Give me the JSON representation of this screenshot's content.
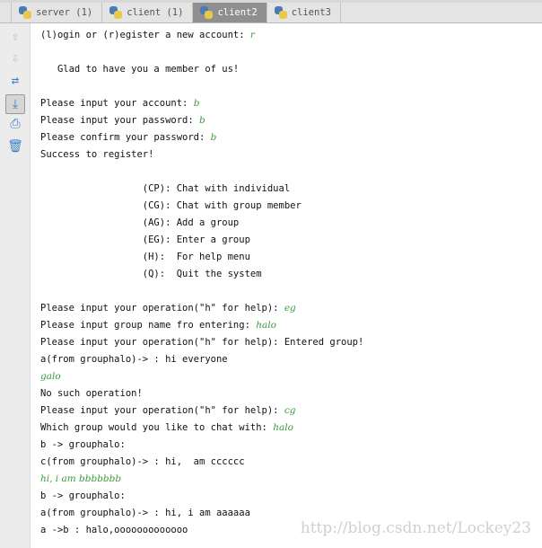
{
  "tabs": [
    {
      "label": "server (1)",
      "active": false
    },
    {
      "label": "client (1)",
      "active": false
    },
    {
      "label": "client2",
      "active": true
    },
    {
      "label": "client3",
      "active": false
    }
  ],
  "sidebar_icons": [
    "arrow-up-icon",
    "arrow-down-icon",
    "soft-wrap-icon",
    "scroll-to-end-icon",
    "print-icon",
    "trash-icon"
  ],
  "console_lines": [
    {
      "text": "(l)ogin or (r)egister a new account: ",
      "input": "r"
    },
    {
      "text": "",
      "input": ""
    },
    {
      "text": "   Glad to have you a member of us!",
      "input": ""
    },
    {
      "text": "",
      "input": ""
    },
    {
      "text": "Please input your account: ",
      "input": "b"
    },
    {
      "text": "Please input your password: ",
      "input": "b"
    },
    {
      "text": "Please confirm your password: ",
      "input": "b"
    },
    {
      "text": "Success to register!",
      "input": ""
    },
    {
      "text": "",
      "input": ""
    },
    {
      "text": "                  (CP): Chat with individual",
      "input": ""
    },
    {
      "text": "                  (CG): Chat with group member",
      "input": ""
    },
    {
      "text": "                  (AG): Add a group",
      "input": ""
    },
    {
      "text": "                  (EG): Enter a group",
      "input": ""
    },
    {
      "text": "                  (H):  For help menu",
      "input": ""
    },
    {
      "text": "                  (Q):  Quit the system",
      "input": ""
    },
    {
      "text": "",
      "input": ""
    },
    {
      "text": "Please input your operation(\"h\" for help): ",
      "input": "eg"
    },
    {
      "text": "Please input group name fro entering: ",
      "input": "halo"
    },
    {
      "text": "Please input your operation(\"h\" for help): Entered group!",
      "input": ""
    },
    {
      "text": "a(from grouphalo)-> : hi everyone",
      "input": ""
    },
    {
      "text": "",
      "input": "galo"
    },
    {
      "text": "No such operation!",
      "input": ""
    },
    {
      "text": "Please input your operation(\"h\" for help): ",
      "input": "cg"
    },
    {
      "text": "Which group would you like to chat with: ",
      "input": "halo"
    },
    {
      "text": "b -> grouphalo:",
      "input": ""
    },
    {
      "text": "c(from grouphalo)-> : hi,  am cccccc",
      "input": ""
    },
    {
      "text": "",
      "input": "hi, i am bbbbbbb"
    },
    {
      "text": "b -> grouphalo:",
      "input": ""
    },
    {
      "text": "a(from grouphalo)-> : hi, i am aaaaaa",
      "input": ""
    },
    {
      "text": "a ->b : halo,ooooooooooooo",
      "input": ""
    }
  ],
  "watermark": "http://blog.csdn.net/Lockey23",
  "colors": {
    "input_text": "#3a9a3a",
    "active_tab": "#8f8f8f"
  }
}
